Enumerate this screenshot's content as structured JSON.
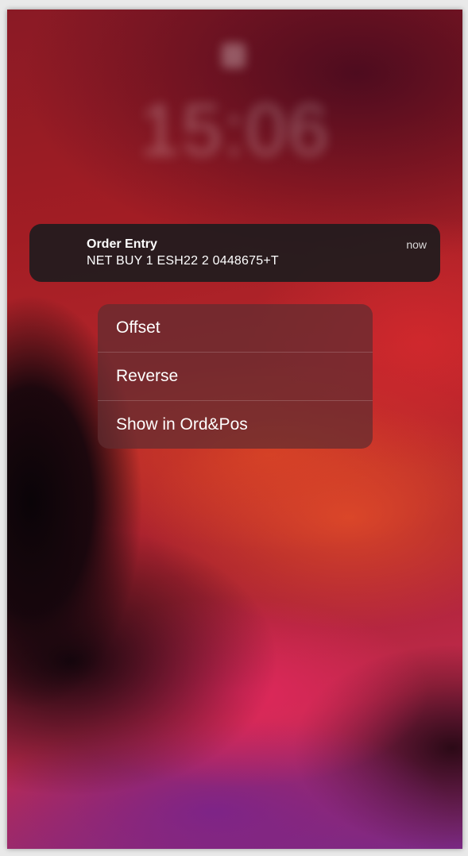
{
  "notification": {
    "title": "Order Entry",
    "body": "NET BUY 1 ESH22 2 0448675+T",
    "time": "now",
    "app_icon": "app-icon"
  },
  "context_menu": {
    "items": [
      {
        "label": "Offset"
      },
      {
        "label": "Reverse"
      },
      {
        "label": "Show in Ord&Pos"
      }
    ]
  },
  "lock_screen": {
    "clock_time": "15:06",
    "lock_icon": "lock-icon"
  },
  "colors": {
    "wallpaper_red": "#a21d24",
    "wallpaper_purple": "#7b2a86",
    "notification_bg": "#221c1e",
    "menu_bg": "#5f2d30"
  }
}
